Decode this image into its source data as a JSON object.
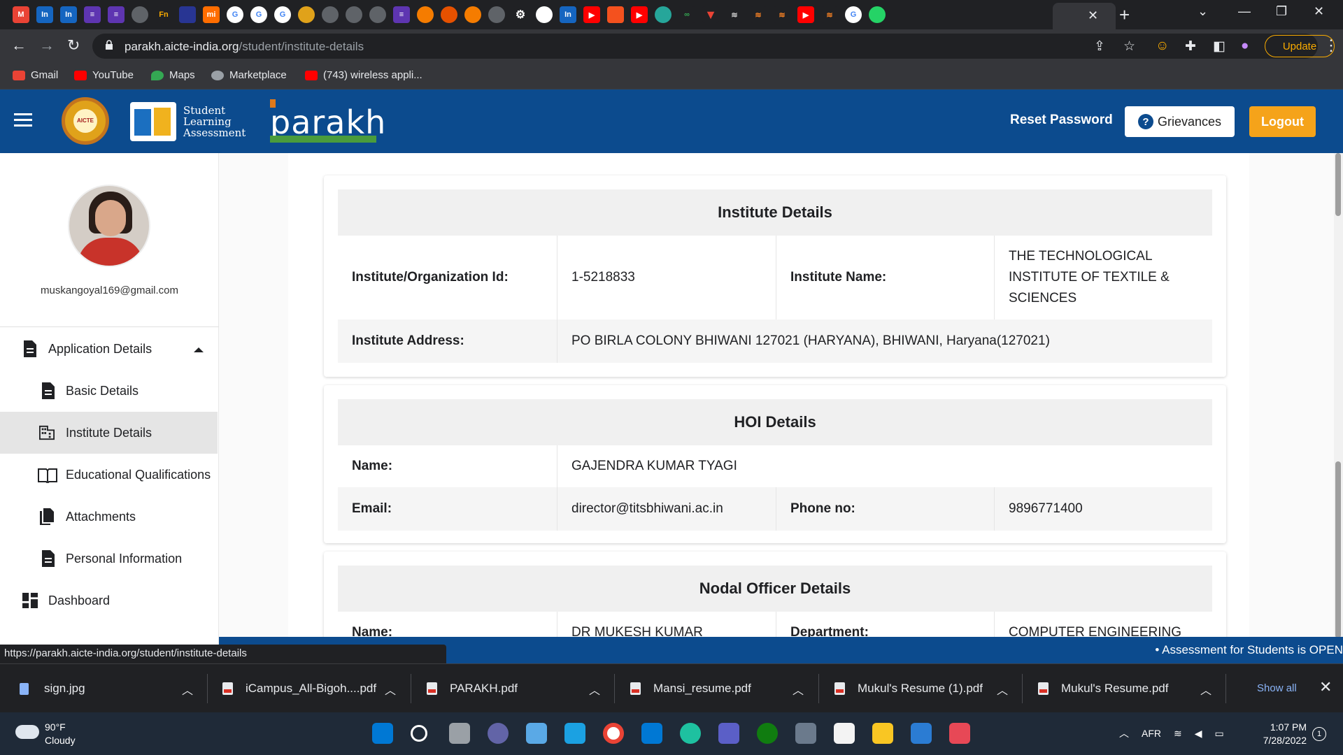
{
  "browser": {
    "url_host": "parakh.aicte-india.org",
    "url_path": "/student/institute-details",
    "update_label": "Update",
    "bookmarks": [
      {
        "label": "Gmail",
        "color": "#ea4335"
      },
      {
        "label": "YouTube",
        "color": "#ff0000"
      },
      {
        "label": "Maps",
        "color": "#34a853"
      },
      {
        "label": "Marketplace",
        "color": "#9aa0a6"
      },
      {
        "label": "(743) wireless appli...",
        "color": "#ff0000"
      }
    ],
    "status_url": "https://parakh.aicte-india.org/student/institute-details"
  },
  "header": {
    "sla_line1": "Student",
    "sla_line2": "Learning",
    "sla_line3": "Assessment",
    "parakh_word": "parakh",
    "reset_password": "Reset Password",
    "grievances": "Grievances",
    "logout": "Logout"
  },
  "sidebar": {
    "email": "muskangoyal169@gmail.com",
    "items": [
      {
        "label": "Application Details"
      },
      {
        "label": "Basic Details"
      },
      {
        "label": "Institute Details"
      },
      {
        "label": "Educational Qualifications"
      },
      {
        "label": "Attachments"
      },
      {
        "label": "Personal Information"
      },
      {
        "label": "Dashboard"
      }
    ]
  },
  "institute": {
    "title": "Institute Details",
    "id_label": "Institute/Organization Id:",
    "id_value": "1-5218833",
    "name_label": "Institute Name:",
    "name_value": "THE TECHNOLOGICAL INSTITUTE OF TEXTILE & SCIENCES",
    "address_label": "Institute Address:",
    "address_value": "PO BIRLA COLONY BHIWANI 127021 (HARYANA), BHIWANI, Haryana(127021)"
  },
  "hoi": {
    "title": "HOI Details",
    "name_label": "Name:",
    "name_value": "GAJENDRA KUMAR TYAGI",
    "email_label": "Email:",
    "email_value": "director@titsbhiwani.ac.in",
    "phone_label": "Phone no:",
    "phone_value": "9896771400"
  },
  "nodal": {
    "title": "Nodal Officer Details",
    "name_label": "Name:",
    "name_value": "DR MUKESH KUMAR",
    "dept_label": "Department:",
    "dept_value": "COMPUTER ENGINEERING"
  },
  "ticker": "• Assessment for Students is OPEN",
  "downloads": [
    {
      "name": "sign.jpg"
    },
    {
      "name": "iCampus_All-Bigoh....pdf"
    },
    {
      "name": "PARAKH.pdf"
    },
    {
      "name": "Mansi_resume.pdf"
    },
    {
      "name": "Mukul's Resume (1).pdf"
    },
    {
      "name": "Mukul's Resume.pdf"
    }
  ],
  "show_all": "Show all",
  "taskbar": {
    "temp": "90°F",
    "condition": "Cloudy",
    "lang": "AFR",
    "time": "1:07 PM",
    "date": "7/28/2022",
    "notifications": "1"
  },
  "colors": {
    "header_blue": "#0c4b8e",
    "logout_orange": "#f5a31a",
    "active_nav": "#e5e5e5"
  }
}
